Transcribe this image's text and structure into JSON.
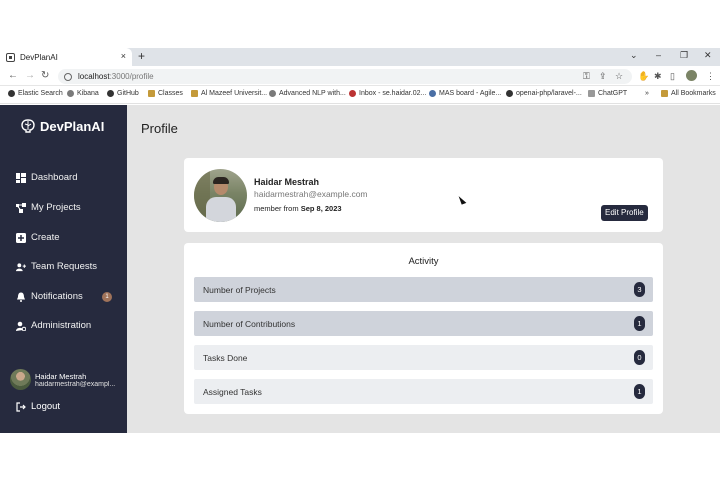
{
  "browser": {
    "tab_title": "DevPlanAI",
    "tab_close": "×",
    "new_tab": "+",
    "url_host": "localhost",
    "url_path": ":3000/profile",
    "bookmarks": [
      "Elastic Search",
      "Kibana",
      "GitHub",
      "Classes",
      "Al Mazeef Universit...",
      "Advanced NLP with...",
      "Inbox - se.haidar.02...",
      "MAS board - Agile...",
      "openai-php/laravel-...",
      "ChatGPT"
    ],
    "more_bookmarks": "»",
    "all_bookmarks": "All Bookmarks"
  },
  "sidebar": {
    "brand": "DevPlanAI",
    "items": [
      {
        "label": "Dashboard",
        "icon": "dashboard-icon"
      },
      {
        "label": "My Projects",
        "icon": "projects-icon"
      },
      {
        "label": "Create",
        "icon": "plus-square-icon"
      },
      {
        "label": "Team Requests",
        "icon": "user-plus-icon"
      },
      {
        "label": "Notifications",
        "icon": "bell-icon",
        "badge": "1"
      },
      {
        "label": "Administration",
        "icon": "user-gear-icon"
      }
    ],
    "user_name": "Haidar Mestrah",
    "user_email": "haidarmestrah@exampl...",
    "logout": "Logout"
  },
  "page": {
    "title": "Profile"
  },
  "profile": {
    "name": "Haidar Mestrah",
    "email": "haidarmestrah@example.com",
    "member_prefix": "member from",
    "member_date": "Sep 8, 2023",
    "edit_button": "Edit Profile"
  },
  "activity": {
    "title": "Activity",
    "rows": [
      {
        "label": "Number of Projects",
        "count": "3"
      },
      {
        "label": "Number of Contributions",
        "count": "1"
      },
      {
        "label": "Tasks Done",
        "count": "0"
      },
      {
        "label": "Assigned Tasks",
        "count": "1"
      }
    ]
  },
  "colors": {
    "sidebar_bg": "#262a3e",
    "main_bg": "#e4e4e4",
    "badge_bg": "#a0735a"
  }
}
